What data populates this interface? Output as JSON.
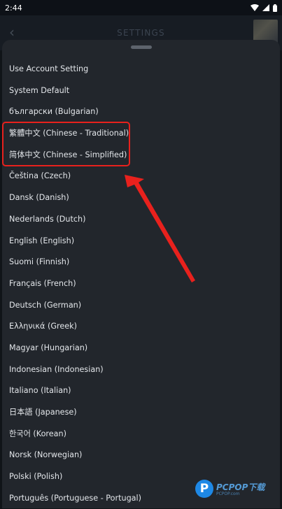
{
  "status_bar": {
    "time": "2:44"
  },
  "app_bar": {
    "title": "SETTINGS"
  },
  "language_list": {
    "items": [
      "Use Account Setting",
      "System Default",
      "български (Bulgarian)",
      "繁體中文 (Chinese - Traditional)",
      "简体中文 (Chinese - Simplified)",
      "Čeština (Czech)",
      "Dansk (Danish)",
      "Nederlands (Dutch)",
      "English (English)",
      "Suomi (Finnish)",
      "Français (French)",
      "Deutsch (German)",
      "Ελληνικά (Greek)",
      "Magyar (Hungarian)",
      "Indonesian (Indonesian)",
      "Italiano (Italian)",
      "日本語 (Japanese)",
      "한국어 (Korean)",
      "Norsk (Norwegian)",
      "Polski (Polish)",
      "Português (Portuguese - Portugal)"
    ]
  },
  "watermark": {
    "logo_letter": "P",
    "brand": "PCPOP下载",
    "sub": "PCPOP.com"
  },
  "colors": {
    "sheet_background": "#22262c",
    "highlight_red": "#e8211d"
  }
}
